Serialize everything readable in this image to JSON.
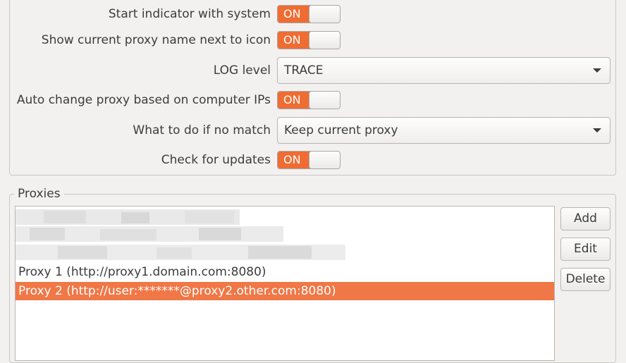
{
  "settings": {
    "start_indicator": {
      "label": "Start indicator with system",
      "value": "ON"
    },
    "show_proxy_name": {
      "label": "Show current proxy name next to icon",
      "value": "ON"
    },
    "log_level": {
      "label": "LOG level",
      "value": "TRACE"
    },
    "auto_change": {
      "label": "Auto change proxy based on computer IPs",
      "value": "ON"
    },
    "no_match": {
      "label": "What to do if no match",
      "value": "Keep current proxy"
    },
    "check_updates": {
      "label": "Check for updates",
      "value": "ON"
    }
  },
  "proxies": {
    "title": "Proxies",
    "items": [
      {
        "label": "Proxy 1 (http://proxy1.domain.com:8080)",
        "selected": false
      },
      {
        "label": "Proxy 2 (http://user:*******@proxy2.other.com:8080)",
        "selected": true
      }
    ],
    "buttons": {
      "add": "Add",
      "edit": "Edit",
      "delete": "Delete"
    }
  },
  "colors": {
    "accent": "#ef6c33",
    "selection": "#f07746",
    "window_bg": "#f2f1f0"
  },
  "icons": {
    "combo_arrow": "chevron-down-icon"
  }
}
